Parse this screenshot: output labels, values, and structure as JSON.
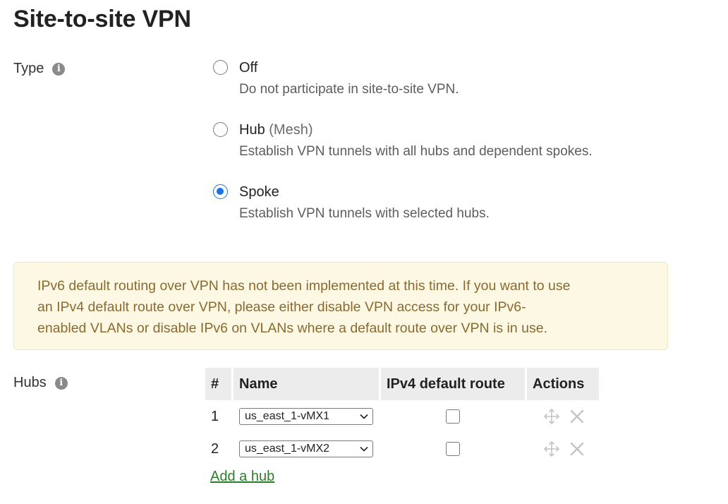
{
  "page": {
    "title": "Site-to-site VPN"
  },
  "type_section": {
    "label": "Type",
    "options": [
      {
        "title": "Off",
        "suffix": "",
        "description": "Do not participate in site-to-site VPN.",
        "checked": false
      },
      {
        "title": "Hub",
        "suffix": "(Mesh)",
        "description": "Establish VPN tunnels with all hubs and dependent spokes.",
        "checked": false
      },
      {
        "title": "Spoke",
        "suffix": "",
        "description": "Establish VPN tunnels with selected hubs.",
        "checked": true
      }
    ]
  },
  "alert": {
    "line1": "IPv6 default routing over VPN has not been implemented at this time. If you want to use",
    "line2": "an IPv4 default route over VPN, please either disable VPN access for your IPv6-",
    "line3": "enabled VLANs or disable IPv6 on VLANs where a default route over VPN is in use."
  },
  "hubs_section": {
    "label": "Hubs",
    "columns": [
      "#",
      "Name",
      "IPv4 default route",
      "Actions"
    ],
    "rows": [
      {
        "num": "1",
        "name": "us_east_1-vMX1",
        "ipv4_default_route": false
      },
      {
        "num": "2",
        "name": "us_east_1-vMX2",
        "ipv4_default_route": false
      }
    ],
    "add_link": "Add a hub"
  },
  "colors": {
    "accent": "#1a73e8",
    "alert_bg": "#fdf8e4",
    "alert_text": "#8a6a2f",
    "link": "#2b7d2b",
    "header_bg": "#ececec"
  },
  "icons": {
    "info": "info-icon",
    "move": "move-arrows-icon",
    "delete": "close-x-icon",
    "dropdown": "chevron-down-icon"
  }
}
